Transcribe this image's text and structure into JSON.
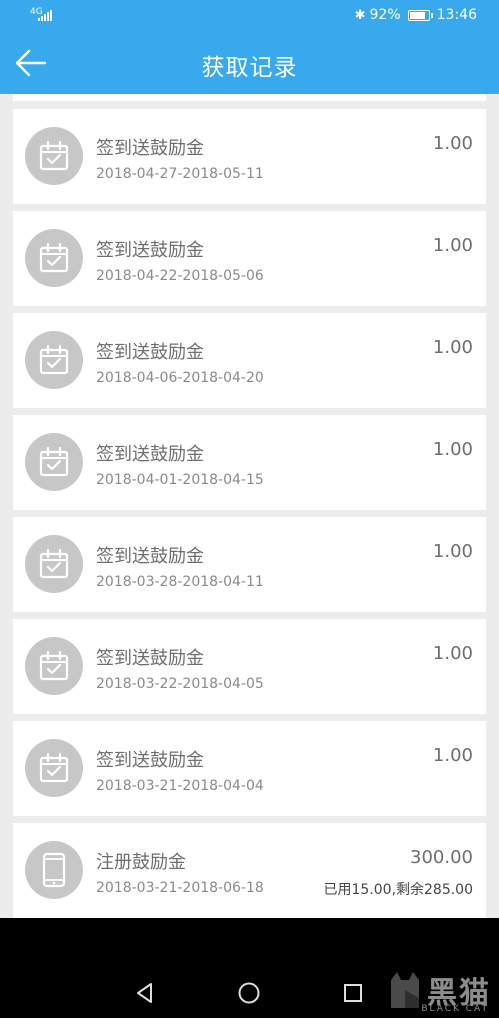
{
  "status_bar": {
    "network": "4G",
    "battery": "92%",
    "battery_level": 0.92,
    "time": "13:46"
  },
  "header": {
    "title": "获取记录"
  },
  "records": [
    {
      "title": "签到送鼓励金",
      "date": "2018-04-27-2018-05-11",
      "amount": "1.00",
      "icon": "calendar-check-icon"
    },
    {
      "title": "签到送鼓励金",
      "date": "2018-04-22-2018-05-06",
      "amount": "1.00",
      "icon": "calendar-check-icon"
    },
    {
      "title": "签到送鼓励金",
      "date": "2018-04-06-2018-04-20",
      "amount": "1.00",
      "icon": "calendar-check-icon"
    },
    {
      "title": "签到送鼓励金",
      "date": "2018-04-01-2018-04-15",
      "amount": "1.00",
      "icon": "calendar-check-icon"
    },
    {
      "title": "签到送鼓励金",
      "date": "2018-03-28-2018-04-11",
      "amount": "1.00",
      "icon": "calendar-check-icon"
    },
    {
      "title": "签到送鼓励金",
      "date": "2018-03-22-2018-04-05",
      "amount": "1.00",
      "icon": "calendar-check-icon"
    },
    {
      "title": "签到送鼓励金",
      "date": "2018-03-21-2018-04-04",
      "amount": "1.00",
      "icon": "calendar-check-icon"
    },
    {
      "title": "注册鼓励金",
      "date": "2018-03-21-2018-06-18",
      "amount": "300.00",
      "note": "已用15.00,剩余285.00",
      "icon": "phone-icon"
    }
  ],
  "watermark": {
    "text": "黑猫",
    "sub": "BLACK CAT"
  },
  "colors": {
    "accent": "#37a9ec",
    "icon_bg": "#c7c7c7",
    "background": "#ececec"
  }
}
